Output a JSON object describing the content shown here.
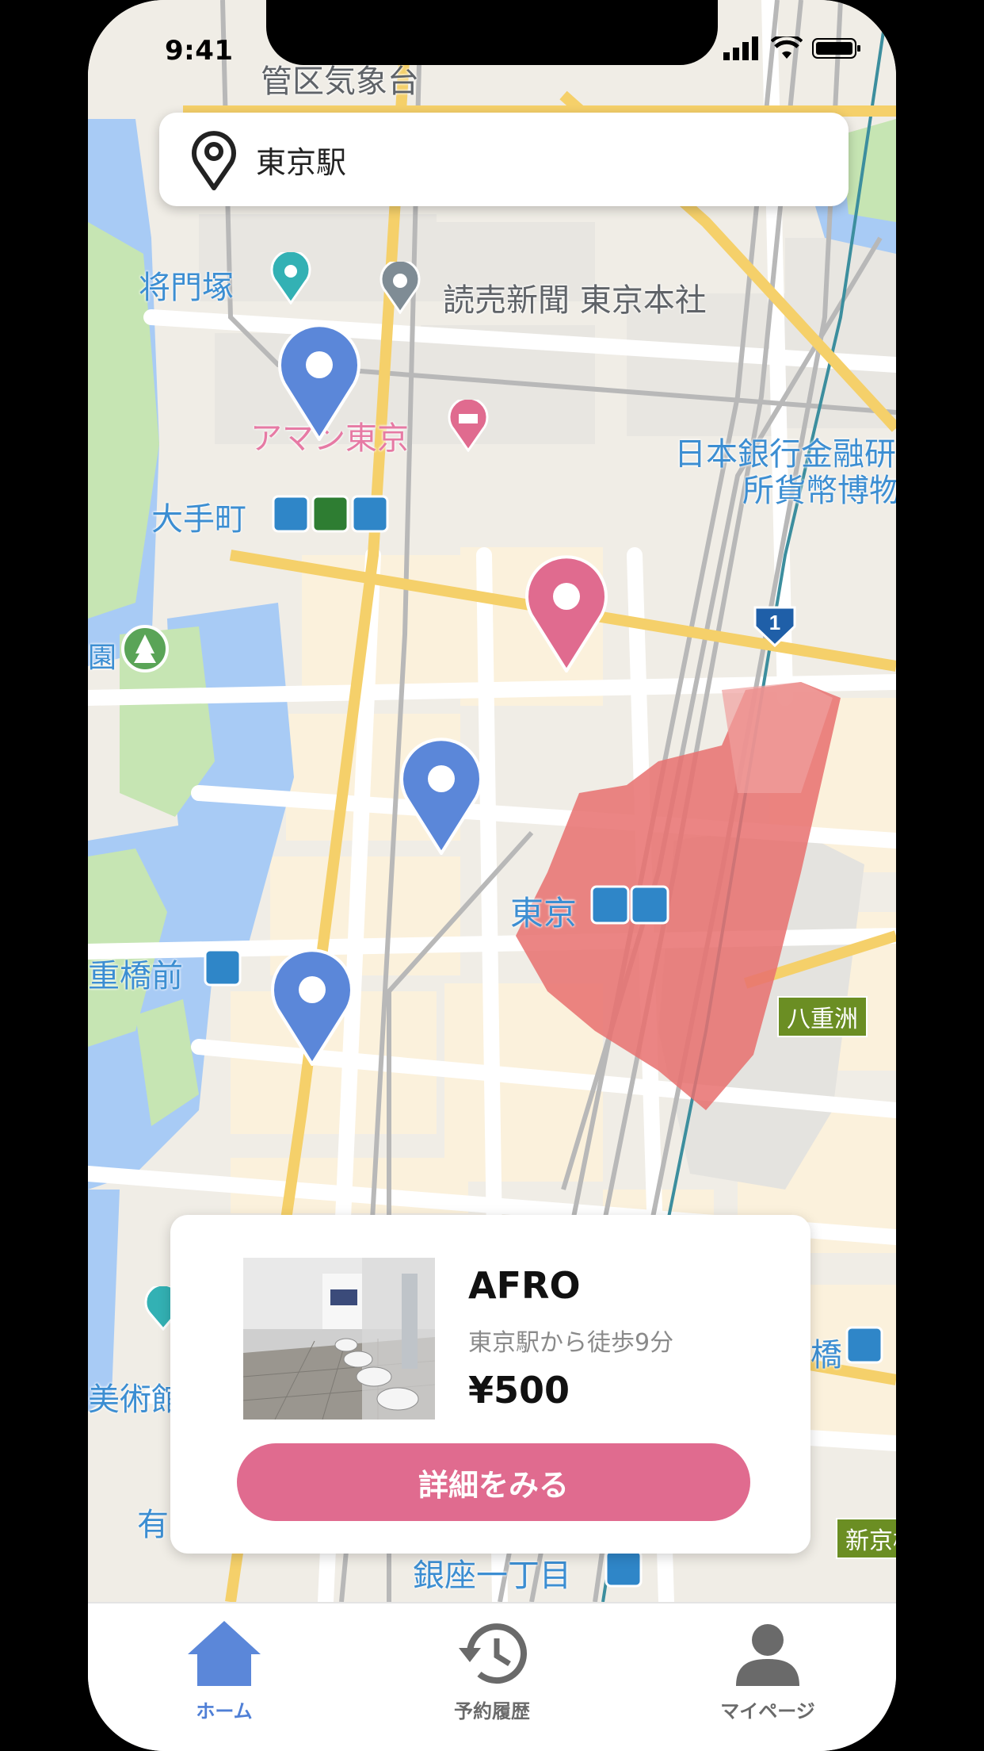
{
  "status_bar": {
    "time": "9:41"
  },
  "search": {
    "value": "東京駅"
  },
  "map_labels": {
    "agency": "管区気象台",
    "masakado": "将門塚",
    "yomiuri": "読売新聞 東京本社",
    "aman": "アマン東京",
    "boj1": "日本銀行金融研",
    "boj2": "所貨幣博物",
    "otemachi": "大手町",
    "tokyo": "東京",
    "yaesu": "八重洲",
    "nijubashi": "重橋前",
    "museum": "美術館",
    "yu": "有",
    "bridge": "橋",
    "ginza": "銀座一丁目",
    "shinkyo": "新京橋",
    "koen": "園",
    "route_no": "1"
  },
  "card": {
    "name": "AFRO",
    "access": "東京駅から徒歩9分",
    "price": "¥500",
    "button_label": "詳細をみる"
  },
  "tabs": [
    {
      "label": "ホーム",
      "icon": "home-icon",
      "active": true
    },
    {
      "label": "予約履歴",
      "icon": "history-icon",
      "active": false
    },
    {
      "label": "マイページ",
      "icon": "person-icon",
      "active": false
    }
  ],
  "colors": {
    "accent_blue": "#5b87d9",
    "accent_pink": "#e06b8f",
    "station_red": "#e8706e"
  }
}
